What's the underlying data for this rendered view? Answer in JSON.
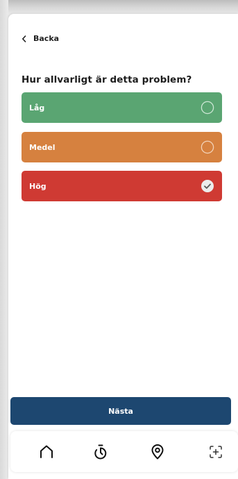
{
  "header": {
    "back_label": "Backa",
    "back_icon": "chevron-left-icon"
  },
  "question": {
    "title": "Hur allvarligt är detta problem?"
  },
  "options": [
    {
      "label": "Låg",
      "color": "#5aa572",
      "selected": false
    },
    {
      "label": "Medel",
      "color": "#d6813f",
      "selected": false
    },
    {
      "label": "Hög",
      "color": "#cf3a33",
      "selected": true
    }
  ],
  "next_button": {
    "label": "Nästa",
    "color": "#1d4770"
  },
  "tabbar": {
    "items": [
      {
        "icon": "home-icon"
      },
      {
        "icon": "timer-icon"
      },
      {
        "icon": "location-pin-icon"
      },
      {
        "icon": "scan-add-icon"
      }
    ]
  }
}
